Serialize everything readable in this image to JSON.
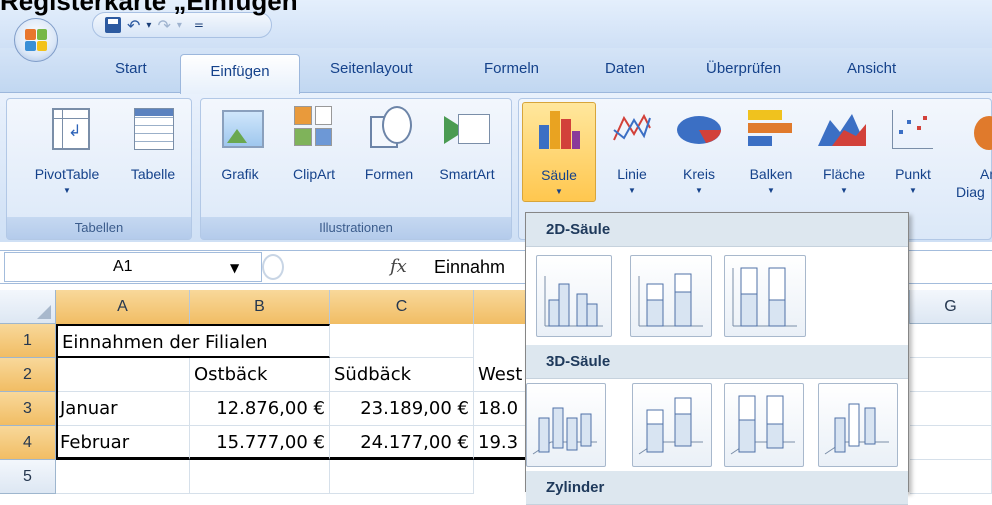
{
  "page_heading": "Registerkarte „Einfügen“",
  "quick_access": {
    "dropdown_glyph": "▾"
  },
  "tabs": [
    "Start",
    "Einfügen",
    "Seitenlayout",
    "Formeln",
    "Daten",
    "Überprüfen",
    "Ansicht"
  ],
  "ribbon": {
    "groups": [
      {
        "label": "Tabellen"
      },
      {
        "label": "Illustrationen"
      }
    ],
    "buttons": {
      "pivottable": "PivotTable",
      "tabelle": "Tabelle",
      "grafik": "Grafik",
      "clipart": "ClipArt",
      "formen": "Formen",
      "smartart": "SmartArt",
      "saeule": "Säule",
      "linie": "Linie",
      "kreis": "Kreis",
      "balken": "Balken",
      "flaeche": "Fläche",
      "punkt": "Punkt",
      "andere_line1": "An",
      "andere_line2": "Diag"
    }
  },
  "formula_bar": {
    "name_box": "A1",
    "fx": "fx",
    "content": "Einnahm"
  },
  "columns": [
    "A",
    "B",
    "C",
    "",
    "",
    "",
    "G"
  ],
  "rows": [
    "1",
    "2",
    "3",
    "4",
    "5"
  ],
  "cells": {
    "A1": "Einnahmen der Filialen",
    "B2": "Ostbäck",
    "C2": "Südbäck",
    "D2": "West",
    "A3": "Januar",
    "B3": "12.876,00 €",
    "C3": "23.189,00 €",
    "D3": "18.0",
    "A4": "Februar",
    "B4": "15.777,00 €",
    "C4": "24.177,00 €",
    "D4": "19.3"
  },
  "dropdown": {
    "sections": [
      "2D-Säule",
      "3D-Säule",
      "Zylinder"
    ]
  },
  "colors": {
    "ribbon_bg": "#dbe8f8",
    "selected_button": "#ffc74f",
    "tab_text": "#15428b"
  }
}
